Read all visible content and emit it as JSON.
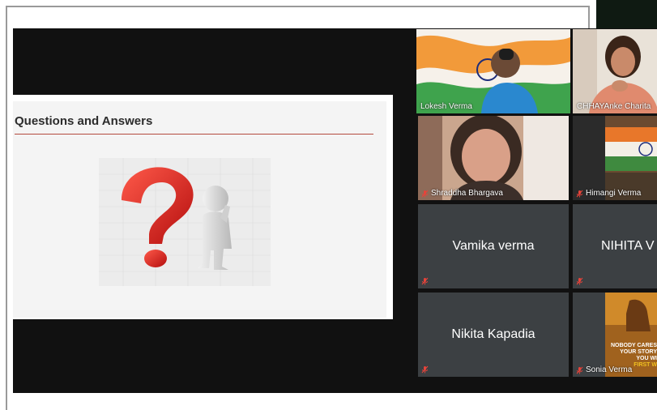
{
  "slide": {
    "title": "Questions and Answers"
  },
  "participants": [
    {
      "name": "Lokesh Verma",
      "muted": false,
      "video": true,
      "active": true
    },
    {
      "name": "CHHAYAnke Charita",
      "muted": false,
      "video": true,
      "active": false
    },
    {
      "name": "Shraddha Bhargava",
      "muted": true,
      "video": true,
      "active": false
    },
    {
      "name": "Himangi Verma",
      "muted": true,
      "video": true,
      "active": false
    },
    {
      "name": "Vamika verma",
      "muted": true,
      "video": false,
      "active": false
    },
    {
      "name": "NIHITA  V",
      "muted": true,
      "video": false,
      "active": false
    },
    {
      "name": "Nikita Kapadia",
      "muted": true,
      "video": false,
      "active": false
    },
    {
      "name": "Sonia Verma",
      "muted": true,
      "video": true,
      "active": false
    }
  ],
  "poster_text": {
    "line1": "NOBODY CARES",
    "line2": "YOUR STORY",
    "line3": "YOU WI",
    "line4": "FIRST W"
  },
  "colors": {
    "tile_bg": "#3c4043",
    "active_border": "#c9d44a",
    "mute_red": "#e8433a",
    "rule": "#b44a3e"
  }
}
